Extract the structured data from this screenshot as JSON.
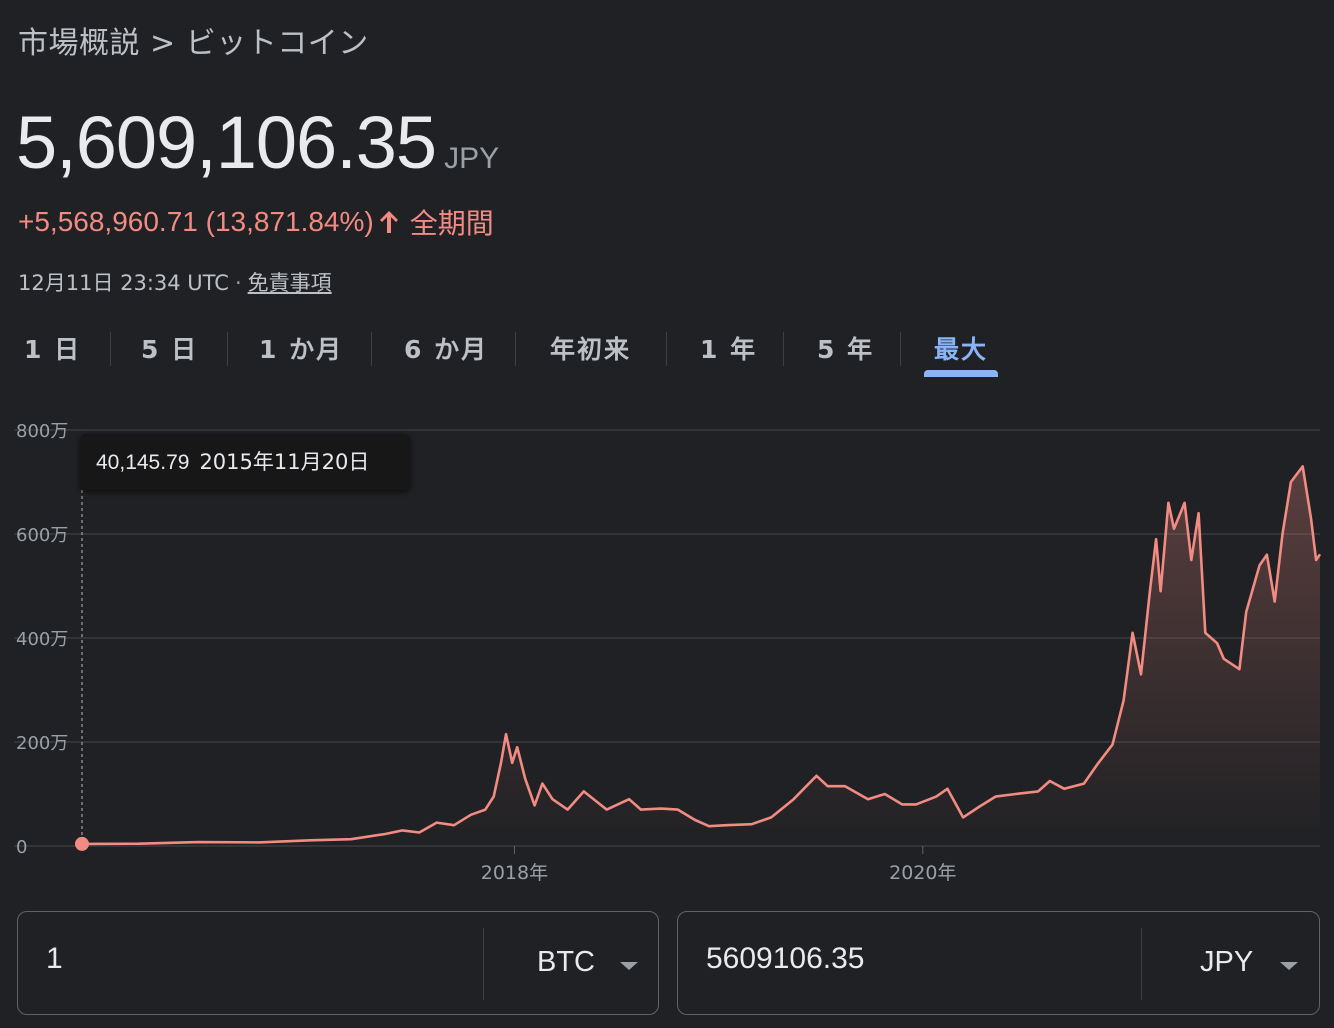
{
  "breadcrumb": "市場概説 > ビットコイン",
  "price": {
    "value": "5,609,106.35",
    "currency": "JPY",
    "change": "+5,568,960.71 (13,871.84%)",
    "period_label": "全期間",
    "timestamp": "12月11日 23:34 UTC",
    "separator": "·",
    "disclaimer": "免責事項"
  },
  "tabs": [
    {
      "label": "1 日"
    },
    {
      "label": "5 日"
    },
    {
      "label": "1 か月"
    },
    {
      "label": "6 か月"
    },
    {
      "label": "年初来"
    },
    {
      "label": "1 年"
    },
    {
      "label": "5 年"
    },
    {
      "label": "最大",
      "active": true
    }
  ],
  "tooltip": {
    "value": "40,145.79",
    "date": "2015年11月20日"
  },
  "colors": {
    "line": "#f28b82",
    "accent": "#8ab4f8",
    "background": "#202124"
  },
  "icons": {
    "change_arrow": "arrow-up-icon",
    "dropdown": "caret-down-icon"
  },
  "chart_data": {
    "type": "area",
    "y_tick_labels": [
      "0",
      "200万",
      "400万",
      "600万",
      "800万"
    ],
    "y_ticks": [
      0,
      2000000,
      4000000,
      6000000,
      8000000
    ],
    "ylim": [
      0,
      8000000
    ],
    "x_tick_labels": [
      "2018年",
      "2020年"
    ],
    "x_ticks": [
      "2018-01-01",
      "2020-01-01"
    ],
    "xlim": [
      "2015-11-20",
      "2021-12-11"
    ],
    "grid": true,
    "series": [
      {
        "points": [
          [
            "2015-11-20",
            40146
          ],
          [
            "2016-03-01",
            45000
          ],
          [
            "2016-06-15",
            75000
          ],
          [
            "2016-10-01",
            70000
          ],
          [
            "2017-01-01",
            110000
          ],
          [
            "2017-03-15",
            130000
          ],
          [
            "2017-05-15",
            230000
          ],
          [
            "2017-06-15",
            300000
          ],
          [
            "2017-07-15",
            260000
          ],
          [
            "2017-08-15",
            450000
          ],
          [
            "2017-09-15",
            400000
          ],
          [
            "2017-10-15",
            600000
          ],
          [
            "2017-11-10",
            700000
          ],
          [
            "2017-11-25",
            950000
          ],
          [
            "2017-12-08",
            1600000
          ],
          [
            "2017-12-17",
            2150000
          ],
          [
            "2017-12-28",
            1600000
          ],
          [
            "2018-01-06",
            1900000
          ],
          [
            "2018-01-20",
            1300000
          ],
          [
            "2018-02-06",
            780000
          ],
          [
            "2018-02-20",
            1200000
          ],
          [
            "2018-03-10",
            900000
          ],
          [
            "2018-04-06",
            700000
          ],
          [
            "2018-05-05",
            1050000
          ],
          [
            "2018-06-15",
            700000
          ],
          [
            "2018-07-25",
            900000
          ],
          [
            "2018-08-15",
            700000
          ],
          [
            "2018-09-20",
            720000
          ],
          [
            "2018-10-20",
            700000
          ],
          [
            "2018-11-20",
            500000
          ],
          [
            "2018-12-15",
            380000
          ],
          [
            "2019-01-15",
            400000
          ],
          [
            "2019-03-01",
            420000
          ],
          [
            "2019-04-05",
            550000
          ],
          [
            "2019-05-15",
            900000
          ],
          [
            "2019-06-25",
            1350000
          ],
          [
            "2019-07-15",
            1150000
          ],
          [
            "2019-08-15",
            1150000
          ],
          [
            "2019-09-25",
            900000
          ],
          [
            "2019-10-25",
            1000000
          ],
          [
            "2019-11-25",
            800000
          ],
          [
            "2019-12-20",
            800000
          ],
          [
            "2020-01-25",
            950000
          ],
          [
            "2020-02-14",
            1100000
          ],
          [
            "2020-03-13",
            550000
          ],
          [
            "2020-04-10",
            750000
          ],
          [
            "2020-05-10",
            950000
          ],
          [
            "2020-06-15",
            1000000
          ],
          [
            "2020-07-25",
            1050000
          ],
          [
            "2020-08-15",
            1250000
          ],
          [
            "2020-09-10",
            1100000
          ],
          [
            "2020-10-15",
            1200000
          ],
          [
            "2020-11-10",
            1600000
          ],
          [
            "2020-12-05",
            1950000
          ],
          [
            "2020-12-25",
            2800000
          ],
          [
            "2021-01-10",
            4100000
          ],
          [
            "2021-01-25",
            3300000
          ],
          [
            "2021-02-10",
            4900000
          ],
          [
            "2021-02-21",
            5900000
          ],
          [
            "2021-03-01",
            4900000
          ],
          [
            "2021-03-15",
            6600000
          ],
          [
            "2021-03-25",
            6100000
          ],
          [
            "2021-04-13",
            6600000
          ],
          [
            "2021-04-25",
            5500000
          ],
          [
            "2021-05-08",
            6400000
          ],
          [
            "2021-05-20",
            4100000
          ],
          [
            "2021-06-10",
            3900000
          ],
          [
            "2021-06-22",
            3600000
          ],
          [
            "2021-07-20",
            3400000
          ],
          [
            "2021-08-01",
            4500000
          ],
          [
            "2021-08-25",
            5400000
          ],
          [
            "2021-09-07",
            5600000
          ],
          [
            "2021-09-21",
            4700000
          ],
          [
            "2021-10-05",
            6000000
          ],
          [
            "2021-10-20",
            7000000
          ],
          [
            "2021-11-10",
            7300000
          ],
          [
            "2021-11-25",
            6300000
          ],
          [
            "2021-12-04",
            5500000
          ],
          [
            "2021-12-11",
            5609106
          ]
        ]
      }
    ]
  },
  "converter": {
    "from_value": "1",
    "from_unit": "BTC",
    "to_value": "5609106.35",
    "to_unit": "JPY"
  }
}
